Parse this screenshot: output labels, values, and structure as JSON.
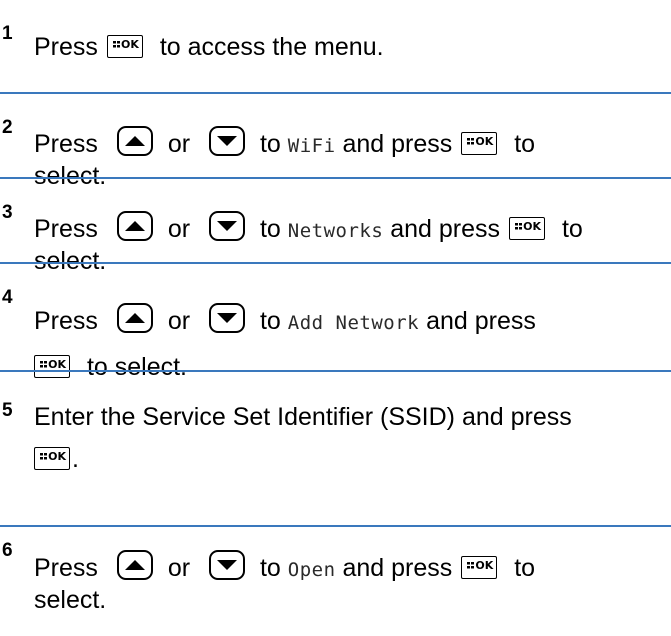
{
  "steps": [
    {
      "number": "1",
      "press": "Press",
      "post": "to access the menu."
    },
    {
      "number": "2",
      "press": "Press",
      "or": "or",
      "to": "to",
      "item": "WiFi",
      "and_press": "and press",
      "to_end": "to",
      "select": "select."
    },
    {
      "number": "3",
      "press": "Press",
      "or": "or",
      "to": "to",
      "item": "Networks",
      "and_press": "and press",
      "to_end": "to",
      "select": "select."
    },
    {
      "number": "4",
      "press": "Press",
      "or": "or",
      "to": "to",
      "item": "Add Network",
      "and_press": "and press",
      "select": "to select."
    },
    {
      "number": "5",
      "text": "Enter the Service Set Identifier (SSID) and press",
      "end": "."
    },
    {
      "number": "6",
      "press": "Press",
      "or": "or",
      "to": "to",
      "item": "Open",
      "and_press": "and press",
      "to_end": "to",
      "select": "select."
    }
  ],
  "icons": {
    "ok_label": "OK",
    "menu_ok_button": "menu-ok-icon",
    "up_button": "up-arrow-icon",
    "down_button": "down-arrow-icon"
  },
  "colors": {
    "divider": "#3a78bd",
    "text": "#000000"
  }
}
